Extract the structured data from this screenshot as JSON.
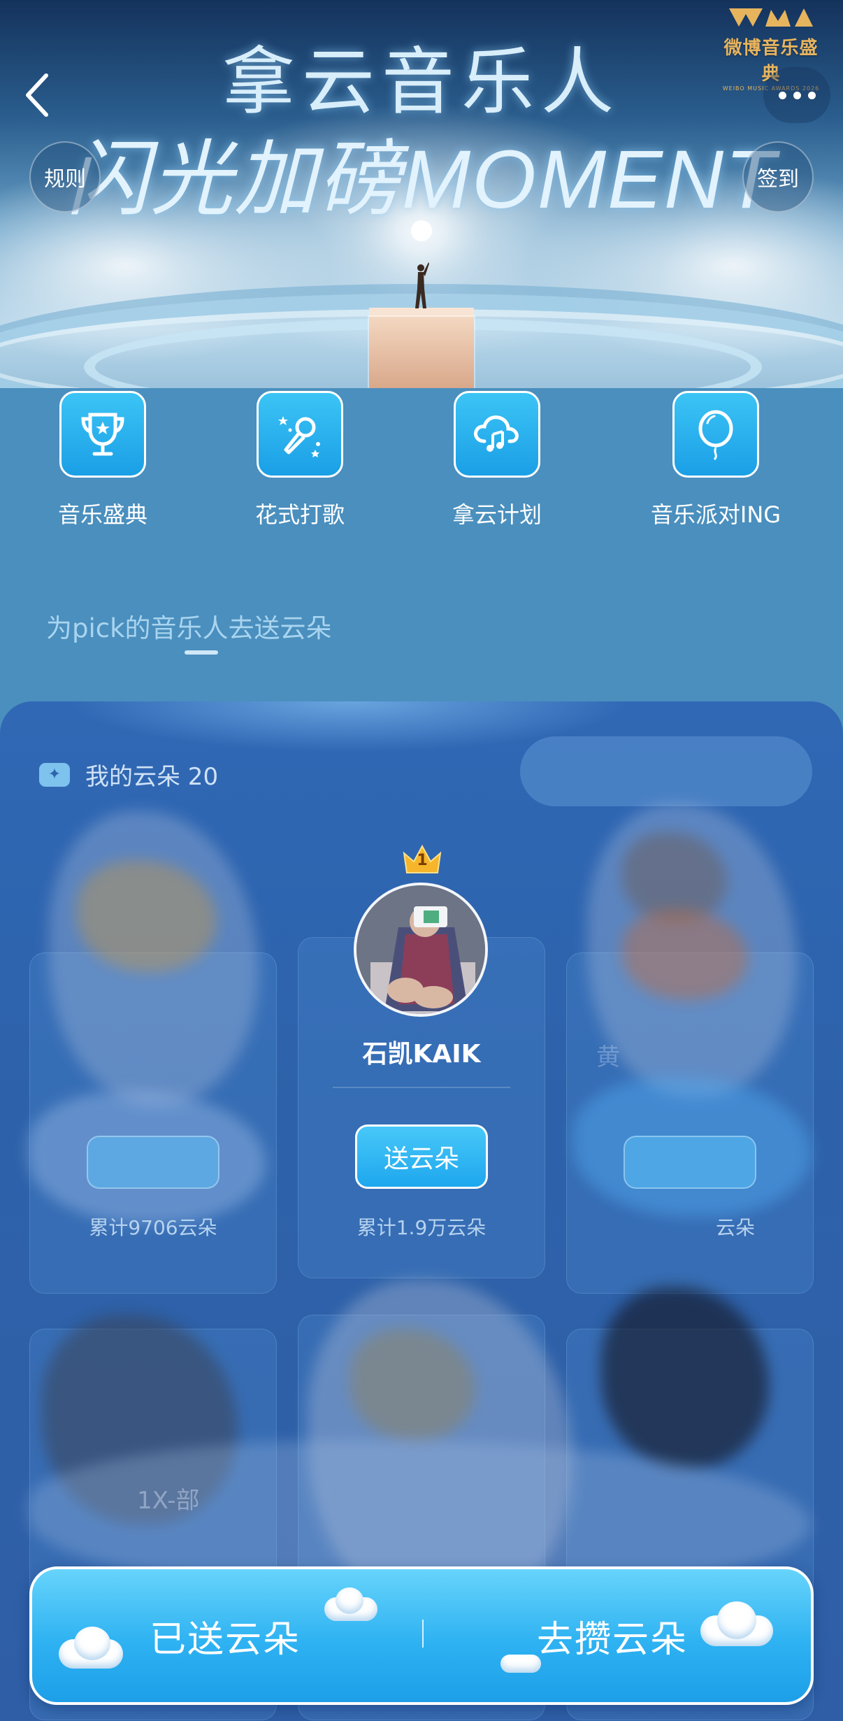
{
  "hero": {
    "title_line1": "拿云音乐人",
    "title_line2": "闪光加磅MOMENT",
    "brand_name": "微博音乐盛典",
    "brand_sub": "WEIBO MUSIC AWARDS 2026",
    "rules_label": "规则",
    "signin_label": "签到"
  },
  "entries": [
    {
      "label": "音乐盛典",
      "icon": "trophy-icon"
    },
    {
      "label": "花式打歌",
      "icon": "microphone-icon"
    },
    {
      "label": "拿云计划",
      "icon": "cloud-music-icon"
    },
    {
      "label": "音乐派对ING",
      "icon": "balloon-icon"
    }
  ],
  "section": {
    "tab_label": "为pick的音乐人去送云朵"
  },
  "panel": {
    "my_clouds": "我的云朵 20",
    "cards": [
      {
        "position": "left",
        "total": "累计9706云朵"
      },
      {
        "position": "center",
        "rank": "1",
        "name": "石凯KAIK",
        "send_label": "送云朵",
        "total": "累计1.9万云朵"
      },
      {
        "position": "right",
        "name_partial": "黄",
        "total": "云朵"
      }
    ],
    "row2_partial_label": "1X-部"
  },
  "bottom_bar": {
    "sent_label": "已送云朵",
    "collect_label": "去攒云朵"
  },
  "colors": {
    "page_bg": "#4a8fbe",
    "panel_bg": "#2f62aa",
    "accent_blue": "#1ea7ee",
    "brand_gold": "#e7b45e"
  }
}
